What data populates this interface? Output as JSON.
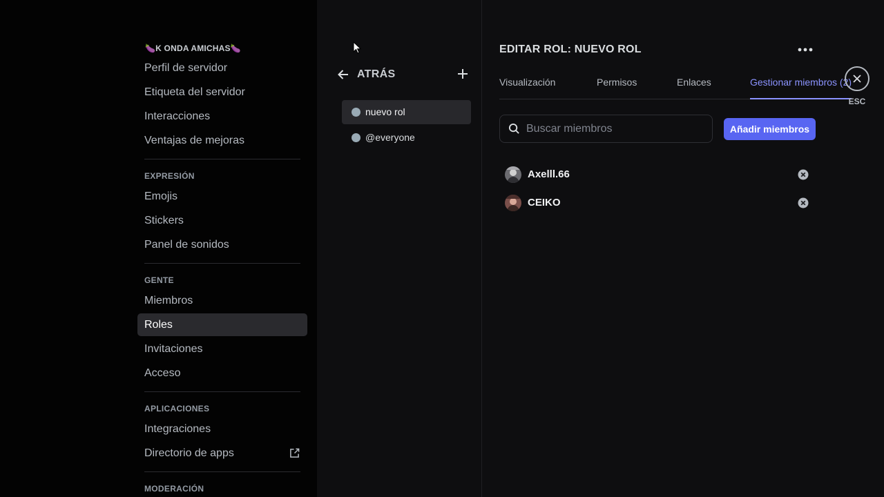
{
  "sidebar": {
    "server_name": "K ONDA AMICHAS",
    "group1": [
      "Perfil de servidor",
      "Etiqueta del servidor",
      "Interacciones",
      "Ventajas de mejoras"
    ],
    "section_expresion": "EXPRESIÓN",
    "group2": [
      "Emojis",
      "Stickers",
      "Panel de sonidos"
    ],
    "section_gente": "GENTE",
    "group3": [
      "Miembros",
      "Roles",
      "Invitaciones",
      "Acceso"
    ],
    "section_aplicaciones": "APLICACIONES",
    "group4": [
      "Integraciones",
      "Directorio de apps"
    ],
    "section_moderacion": "MODERACIÓN"
  },
  "roles_panel": {
    "back_label": "ATRÁS",
    "roles": [
      {
        "name": "nuevo rol",
        "color": "#99aab5"
      },
      {
        "name": "@everyone",
        "color": "#99aab5"
      }
    ]
  },
  "editor": {
    "title": "EDITAR ROL: NUEVO ROL",
    "tabs": [
      "Visualización",
      "Permisos",
      "Enlaces",
      "Gestionar miembros (2)"
    ],
    "active_tab": "Gestionar miembros (2)",
    "search_placeholder": "Buscar miembros",
    "add_button": "Añadir miembros",
    "members": [
      "Axelll.66",
      "CEIKO"
    ]
  },
  "close": {
    "esc_label": "ESC"
  },
  "colors": {
    "accent": "#5865f2",
    "active_tab": "#8b93ff",
    "background": "#0e0e10",
    "sidebar": "#030303"
  }
}
